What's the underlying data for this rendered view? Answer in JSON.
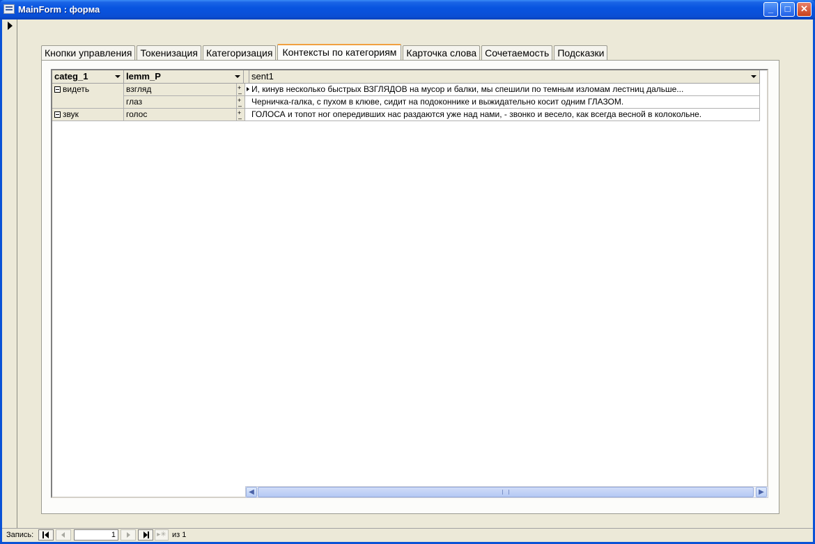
{
  "window": {
    "title": "MainForm : форма"
  },
  "tabs": [
    {
      "label": "Кнопки управления",
      "active": false
    },
    {
      "label": "Токенизация",
      "active": false
    },
    {
      "label": "Категоризация",
      "active": false
    },
    {
      "label": "Контексты по категориям",
      "active": true
    },
    {
      "label": "Карточка слова",
      "active": false
    },
    {
      "label": "Сочетаемость",
      "active": false
    },
    {
      "label": "Подсказки",
      "active": false
    }
  ],
  "grid": {
    "columns": {
      "categ": "categ_1",
      "lemm": "lemm_P",
      "sent": "sent1"
    },
    "groups": [
      {
        "categ": "видеть",
        "rows": [
          {
            "lemm": "взгляд",
            "sent": "И, кинув несколько быстрых ВЗГЛЯДОВ на мусор и балки, мы спешили по темным изломам лестниц дальше..."
          },
          {
            "lemm": "глаз",
            "sent": "Черничка-галка, с пухом в клюве, сидит на подоконнике и выжидательно косит одним ГЛАЗОМ."
          }
        ]
      },
      {
        "categ": "звук",
        "rows": [
          {
            "lemm": "голос",
            "sent": "ГОЛОСА и топот ног опередивших нас раздаются уже над нами, - звонко и весело, как всегда весной в колокольне."
          }
        ]
      }
    ]
  },
  "navigation": {
    "label": "Запись:",
    "current": "1",
    "of_label": "из",
    "total": "1"
  }
}
